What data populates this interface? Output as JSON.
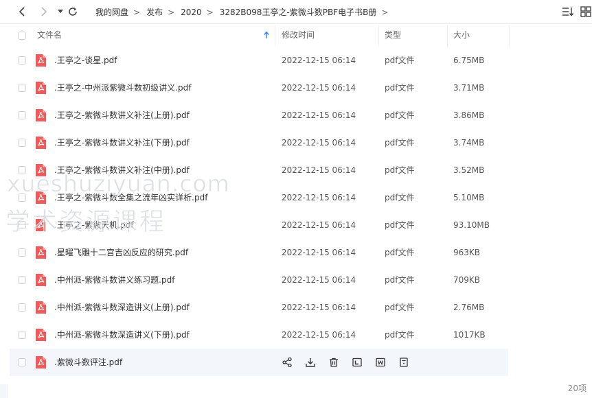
{
  "breadcrumb": [
    "我的网盘",
    "发布",
    "2020",
    "3282B098王亭之-紫微斗数PBF电子书B册"
  ],
  "columns": {
    "name": "文件名",
    "modified": "修改时间",
    "type": "类型",
    "size": "大小"
  },
  "files": [
    {
      "name": ".王亭之-谈星.pdf",
      "date": "2022-12-15 06:14",
      "type": "pdf文件",
      "size": "6.75MB"
    },
    {
      "name": ".王亭之-中州派紫微斗数初级讲义.pdf",
      "date": "2022-12-15 06:14",
      "type": "pdf文件",
      "size": "3.71MB"
    },
    {
      "name": ".王亭之-紫微斗数讲义补注(上册).pdf",
      "date": "2022-12-15 06:14",
      "type": "pdf文件",
      "size": "3.86MB"
    },
    {
      "name": ".王亭之-紫微斗数讲义补注(下册).pdf",
      "date": "2022-12-15 06:14",
      "type": "pdf文件",
      "size": "3.74MB"
    },
    {
      "name": ".王亭之-紫微斗数讲义补注(中册).pdf",
      "date": "2022-12-15 06:14",
      "type": "pdf文件",
      "size": "3.52MB"
    },
    {
      "name": ".王亭之-紫微斗数全集之流年凶实详析.pdf",
      "date": "2022-12-15 06:14",
      "type": "pdf文件",
      "size": "5.10MB"
    },
    {
      "name": ".王亭之-紫微天机.pdf",
      "date": "2022-12-15 06:14",
      "type": "pdf文件",
      "size": "93.10MB"
    },
    {
      "name": ".星曜飞雕十二宫吉凶反应的研究.pdf",
      "date": "2022-12-15 06:14",
      "type": "pdf文件",
      "size": "963KB"
    },
    {
      "name": ".中州派-紫微斗数讲义练习题.pdf",
      "date": "2022-12-15 06:14",
      "type": "pdf文件",
      "size": "709KB"
    },
    {
      "name": ".中州派-紫微斗数深造讲义(上册).pdf",
      "date": "2022-12-15 06:14",
      "type": "pdf文件",
      "size": "2.76MB"
    },
    {
      "name": ".中州派-紫微斗数深造讲义(下册).pdf",
      "date": "2022-12-15 06:14",
      "type": "pdf文件",
      "size": "1017KB"
    },
    {
      "name": ".紫微斗数评注.pdf"
    }
  ],
  "hover_actions": [
    "share-icon",
    "download-icon",
    "delete-icon",
    "copy-icon",
    "rename-icon",
    "more-icon"
  ],
  "watermark": {
    "line1": "xueshuziyuan.com",
    "line2": "学术资源课程"
  },
  "item_count": "20项",
  "colors": {
    "accent": "#2a7ef6",
    "pdf_icon": "#ef5a5a",
    "hover_row": "#f3f6fa"
  }
}
